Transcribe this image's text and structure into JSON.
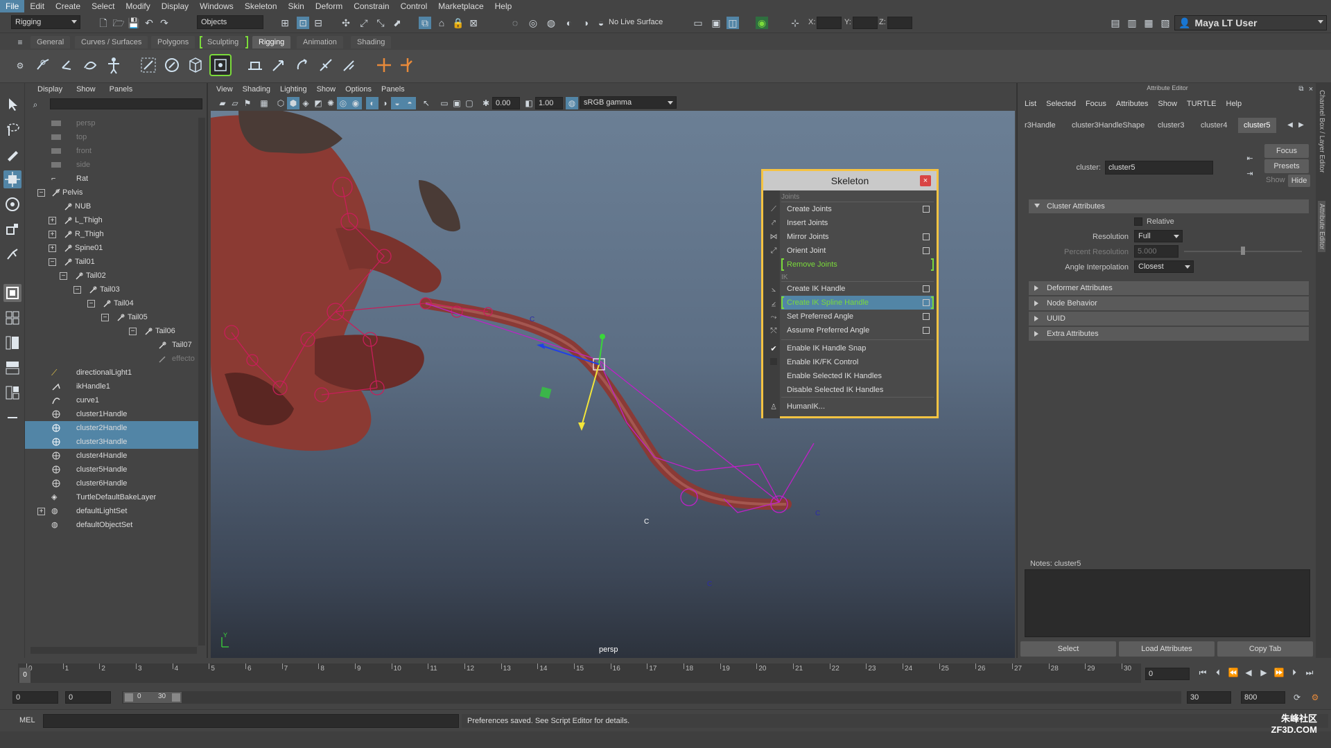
{
  "menubar": {
    "items": [
      "File",
      "Edit",
      "Create",
      "Select",
      "Modify",
      "Display",
      "Windows",
      "Skeleton",
      "Skin",
      "Deform",
      "Constrain",
      "Control",
      "Marketplace",
      "Help"
    ]
  },
  "statusline": {
    "menuset": "Rigging",
    "selection_mode": "Objects",
    "live_surface": "No Live Surface",
    "x_label": "X:",
    "y_label": "Y:",
    "z_label": "Z:",
    "user": "Maya LT User"
  },
  "shelf_tabs": [
    "General",
    "Curves / Surfaces",
    "Polygons",
    "Sculpting",
    "Rigging",
    "Animation",
    "Shading"
  ],
  "shelf_active": "Rigging",
  "outliner": {
    "menu": [
      "Display",
      "Show",
      "Panels"
    ],
    "items": [
      {
        "label": "persp",
        "dim": true
      },
      {
        "label": "top",
        "dim": true
      },
      {
        "label": "front",
        "dim": true
      },
      {
        "label": "side",
        "dim": true
      },
      {
        "label": "Rat"
      },
      {
        "label": "Pelvis"
      },
      {
        "label": "NUB"
      },
      {
        "label": "L_Thigh"
      },
      {
        "label": "R_Thigh"
      },
      {
        "label": "Spine01"
      },
      {
        "label": "Tail01"
      },
      {
        "label": "Tail02"
      },
      {
        "label": "Tail03"
      },
      {
        "label": "Tail04"
      },
      {
        "label": "Tail05"
      },
      {
        "label": "Tail06"
      },
      {
        "label": "Tail07"
      },
      {
        "label": "effecto",
        "dim": true
      },
      {
        "label": "directionalLight1"
      },
      {
        "label": "ikHandle1"
      },
      {
        "label": "curve1"
      },
      {
        "label": "cluster1Handle"
      },
      {
        "label": "cluster2Handle",
        "selected": true
      },
      {
        "label": "cluster3Handle",
        "selected": true
      },
      {
        "label": "cluster4Handle"
      },
      {
        "label": "cluster5Handle"
      },
      {
        "label": "cluster6Handle"
      },
      {
        "label": "TurtleDefaultBakeLayer"
      },
      {
        "label": "defaultLightSet"
      },
      {
        "label": "defaultObjectSet"
      }
    ]
  },
  "viewport": {
    "menu": [
      "View",
      "Shading",
      "Lighting",
      "Show",
      "Options",
      "Panels"
    ],
    "exposure": "0.00",
    "gamma": "1.00",
    "color_space": "sRGB gamma",
    "camera_label": "persp",
    "axis_y": "Y",
    "curve_labels": [
      "C",
      "C",
      "C",
      "C"
    ]
  },
  "skeleton_menu": {
    "title": "Skeleton",
    "close": "×",
    "section_joints": "Joints",
    "section_ik": "IK",
    "items": {
      "create_joints": "Create Joints",
      "insert_joints": "Insert Joints",
      "mirror_joints": "Mirror Joints",
      "orient_joint": "Orient Joint",
      "remove_joints": "Remove Joints",
      "create_ik_handle": "Create IK Handle",
      "create_ik_spline_handle": "Create IK Spline Handle",
      "set_preferred_angle": "Set Preferred Angle",
      "assume_preferred_angle": "Assume Preferred Angle",
      "enable_ik_handle_snap": "Enable IK Handle Snap",
      "enable_ikfk_control": "Enable IK/FK Control",
      "enable_selected_ik_handles": "Enable Selected IK Handles",
      "disable_selected_ik_handles": "Disable Selected IK Handles",
      "humanik": "HumanIK..."
    }
  },
  "attribute_editor": {
    "title": "Attribute Editor",
    "menu": [
      "List",
      "Selected",
      "Focus",
      "Attributes",
      "Show",
      "TURTLE",
      "Help"
    ],
    "tabs": [
      "r3Handle",
      "cluster3HandleShape",
      "cluster3",
      "cluster4",
      "cluster5"
    ],
    "active_tab": "cluster5",
    "cluster_label": "cluster:",
    "cluster_value": "cluster5",
    "focus_button": "Focus",
    "presets_button": "Presets",
    "show_label": "Show",
    "hide_button": "Hide",
    "sections": {
      "cluster_attributes": "Cluster Attributes",
      "deformer_attributes": "Deformer Attributes",
      "node_behavior": "Node Behavior",
      "uuid": "UUID",
      "extra_attributes": "Extra Attributes"
    },
    "relative_label": "Relative",
    "resolution_label": "Resolution",
    "resolution_value": "Full",
    "percent_resolution_label": "Percent Resolution",
    "percent_resolution_value": "5.000",
    "angle_interp_label": "Angle Interpolation",
    "angle_interp_value": "Closest",
    "notes_label": "Notes:  cluster5",
    "buttons": {
      "select": "Select",
      "load": "Load Attributes",
      "copy": "Copy Tab"
    }
  },
  "side_tabs": [
    "Channel Box / Layer Editor",
    "Attribute Editor"
  ],
  "timeslider": {
    "ticks": [
      "0",
      "1",
      "2",
      "3",
      "4",
      "5",
      "6",
      "7",
      "8",
      "9",
      "10",
      "11",
      "12",
      "13",
      "14",
      "15",
      "16",
      "17",
      "18",
      "19",
      "20",
      "21",
      "22",
      "23",
      "24",
      "25",
      "26",
      "27",
      "28",
      "29",
      "30"
    ],
    "current_frame": "0",
    "current_time_field": "0"
  },
  "rangeslider": {
    "start": "0",
    "anim_start": "0",
    "range_start": "0",
    "range_end": "30",
    "end": "30",
    "anim_end": "800"
  },
  "cmdline": {
    "lang": "MEL",
    "feedback": "Preferences saved. See Script Editor for details."
  },
  "watermark": "朱峰社区 ZF3D.COM"
}
